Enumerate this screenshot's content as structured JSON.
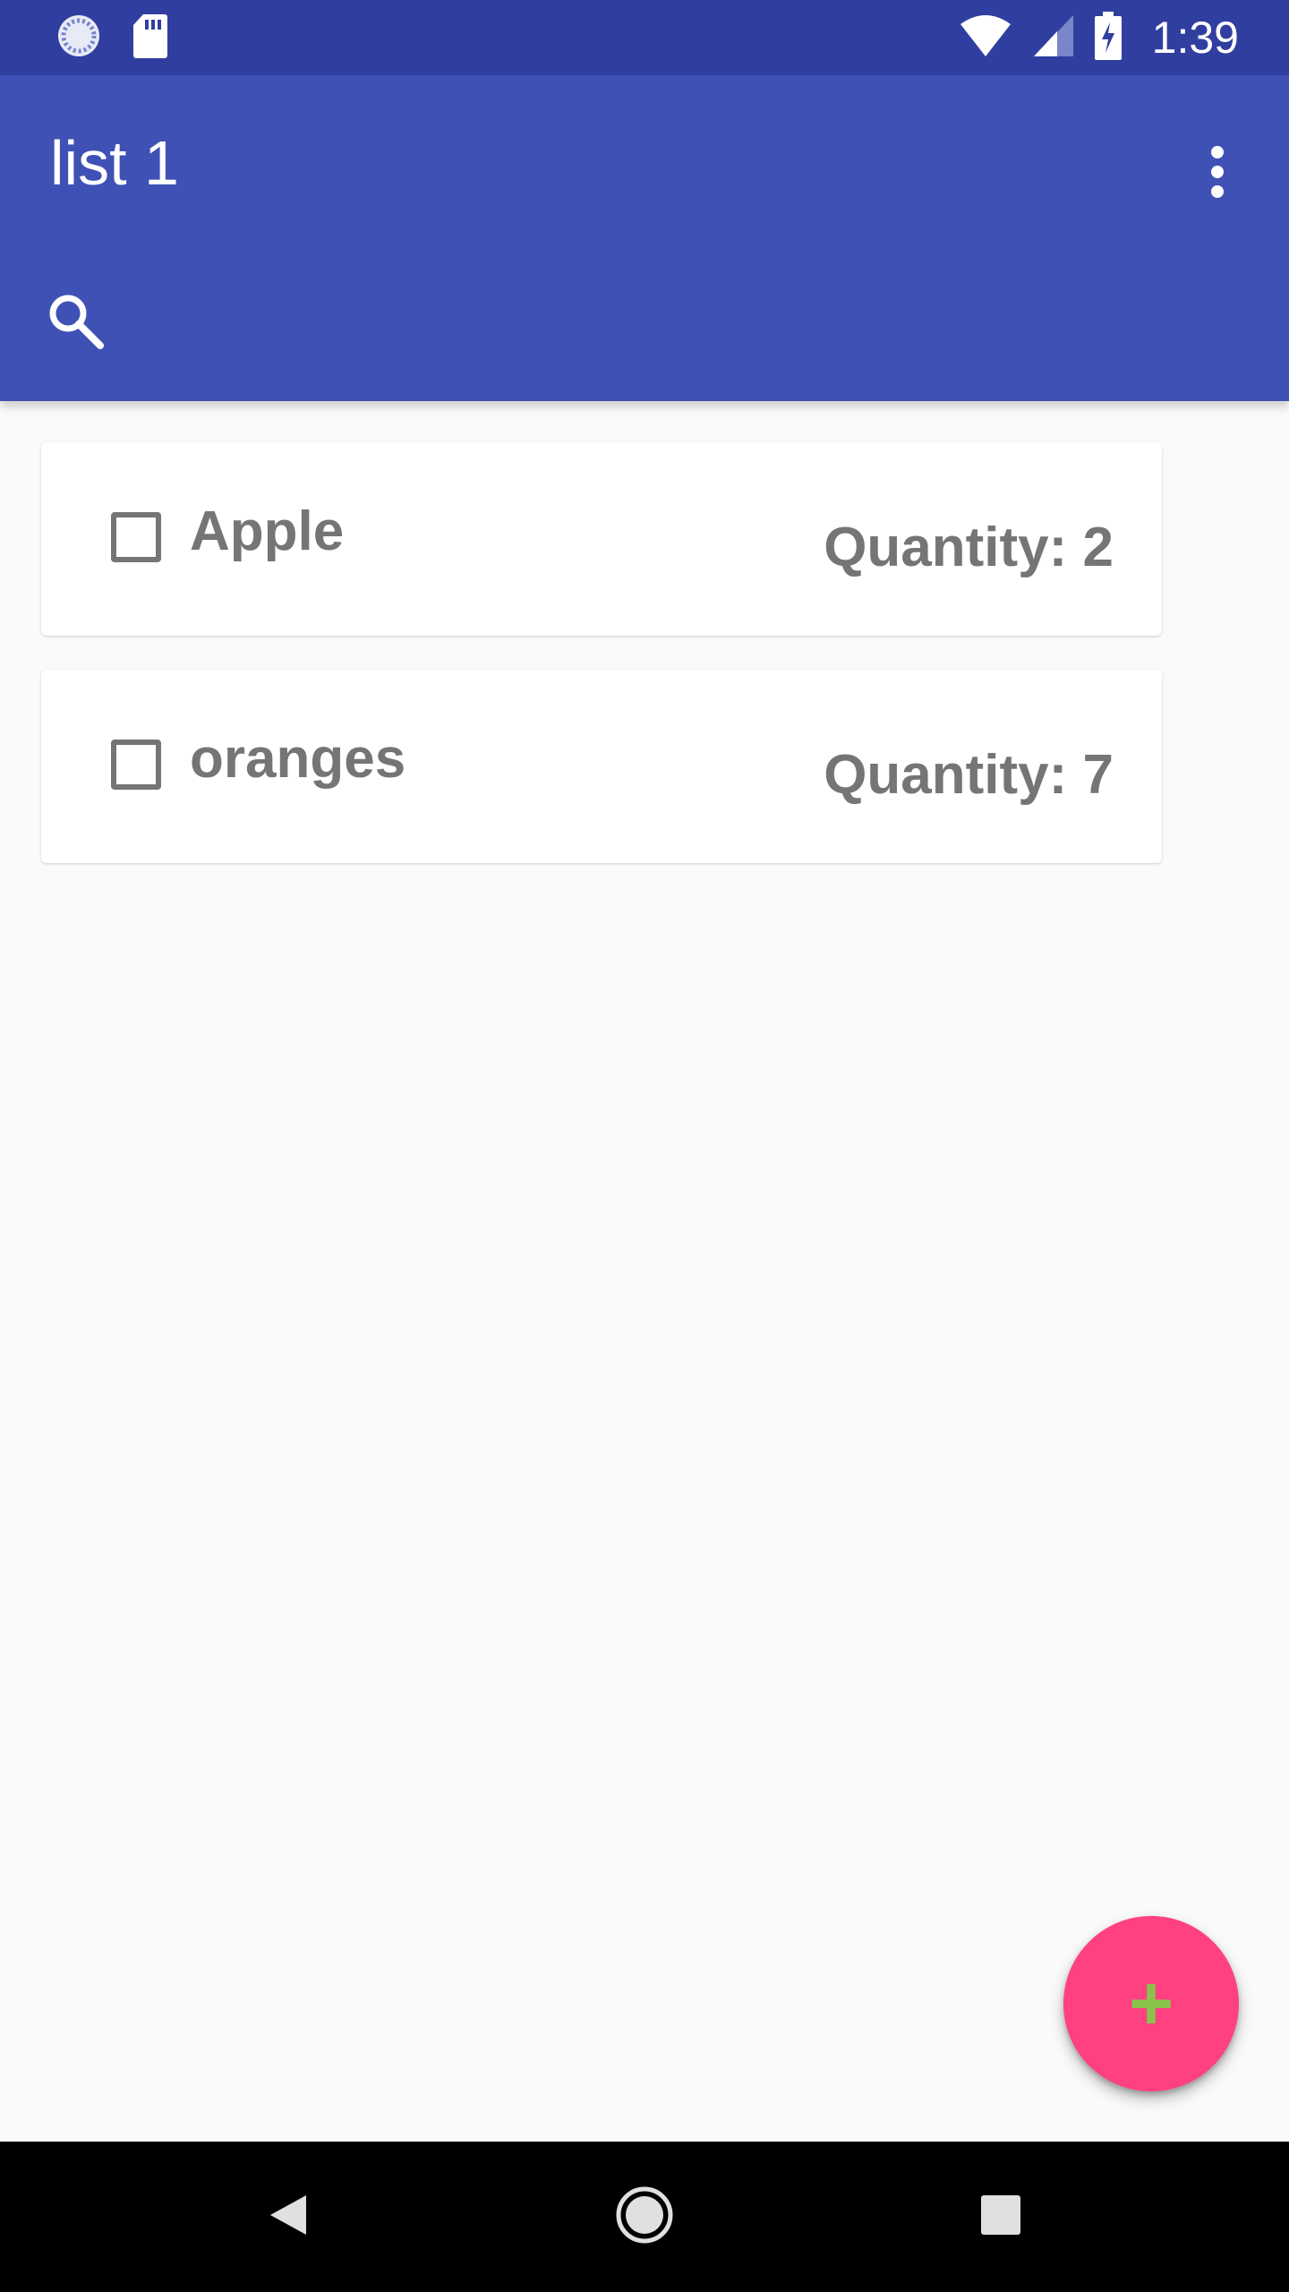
{
  "status_bar": {
    "time": "1:39",
    "icons": [
      "sync-icon",
      "sd-card-icon",
      "wifi-icon",
      "cell-signal-icon",
      "battery-charging-icon"
    ]
  },
  "app_bar": {
    "title": "list 1",
    "overflow_icon": "more-vert-icon",
    "search_icon": "search-icon"
  },
  "items": [
    {
      "name": "Apple",
      "quantity_label": "Quantity: 2",
      "checked": false
    },
    {
      "name": "oranges",
      "quantity_label": "Quantity: 7",
      "checked": false
    }
  ],
  "fab": {
    "label": "+",
    "icon": "add-icon"
  },
  "nav_bar": {
    "icons": [
      "back-icon",
      "home-icon",
      "recents-icon"
    ]
  },
  "colors": {
    "status_bar": "#303f9f",
    "app_bar": "#3f51b5",
    "background": "#fafafa",
    "card": "#ffffff",
    "item_text": "#757575",
    "fab": "#ff4081",
    "fab_plus": "#8bc34a",
    "nav_bar": "#000000"
  }
}
